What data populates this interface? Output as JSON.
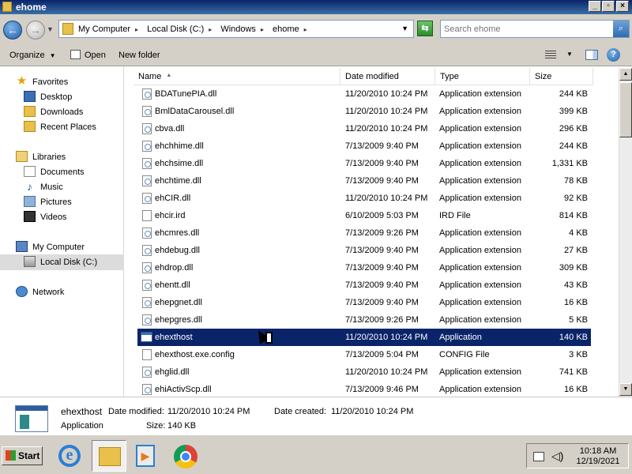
{
  "window": {
    "title": "ehome"
  },
  "address": {
    "crumbs": [
      "My Computer",
      "Local Disk (C:)",
      "Windows",
      "ehome"
    ],
    "search_placeholder": "Search ehome"
  },
  "toolbar": {
    "organize": "Organize",
    "open": "Open",
    "new_folder": "New folder"
  },
  "nav": {
    "favorites": "Favorites",
    "desktop": "Desktop",
    "downloads": "Downloads",
    "recent": "Recent Places",
    "libraries": "Libraries",
    "documents": "Documents",
    "music": "Music",
    "pictures": "Pictures",
    "videos": "Videos",
    "computer": "My Computer",
    "local_disk": "Local Disk (C:)",
    "network": "Network"
  },
  "columns": {
    "name": "Name",
    "date": "Date modified",
    "type": "Type",
    "size": "Size"
  },
  "files": [
    {
      "name": "BDATunePIA.dll",
      "date": "11/20/2010 10:24 PM",
      "type": "Application extension",
      "size": "244 KB",
      "kind": "dll"
    },
    {
      "name": "BmlDataCarousel.dll",
      "date": "11/20/2010 10:24 PM",
      "type": "Application extension",
      "size": "399 KB",
      "kind": "dll"
    },
    {
      "name": "cbva.dll",
      "date": "11/20/2010 10:24 PM",
      "type": "Application extension",
      "size": "296 KB",
      "kind": "dll"
    },
    {
      "name": "ehchhime.dll",
      "date": "7/13/2009 9:40 PM",
      "type": "Application extension",
      "size": "244 KB",
      "kind": "dll"
    },
    {
      "name": "ehchsime.dll",
      "date": "7/13/2009 9:40 PM",
      "type": "Application extension",
      "size": "1,331 KB",
      "kind": "dll"
    },
    {
      "name": "ehchtime.dll",
      "date": "7/13/2009 9:40 PM",
      "type": "Application extension",
      "size": "78 KB",
      "kind": "dll"
    },
    {
      "name": "ehCIR.dll",
      "date": "11/20/2010 10:24 PM",
      "type": "Application extension",
      "size": "92 KB",
      "kind": "dll"
    },
    {
      "name": "ehcir.ird",
      "date": "6/10/2009 5:03 PM",
      "type": "IRD File",
      "size": "814 KB",
      "kind": "file"
    },
    {
      "name": "ehcmres.dll",
      "date": "7/13/2009 9:26 PM",
      "type": "Application extension",
      "size": "4 KB",
      "kind": "dll"
    },
    {
      "name": "ehdebug.dll",
      "date": "7/13/2009 9:40 PM",
      "type": "Application extension",
      "size": "27 KB",
      "kind": "dll"
    },
    {
      "name": "ehdrop.dll",
      "date": "7/13/2009 9:40 PM",
      "type": "Application extension",
      "size": "309 KB",
      "kind": "dll"
    },
    {
      "name": "ehentt.dll",
      "date": "7/13/2009 9:40 PM",
      "type": "Application extension",
      "size": "43 KB",
      "kind": "dll"
    },
    {
      "name": "ehepgnet.dll",
      "date": "7/13/2009 9:40 PM",
      "type": "Application extension",
      "size": "16 KB",
      "kind": "dll"
    },
    {
      "name": "ehepgres.dll",
      "date": "7/13/2009 9:26 PM",
      "type": "Application extension",
      "size": "5 KB",
      "kind": "dll"
    },
    {
      "name": "ehexthost",
      "date": "11/20/2010 10:24 PM",
      "type": "Application",
      "size": "140 KB",
      "kind": "app",
      "selected": true
    },
    {
      "name": "ehexthost.exe.config",
      "date": "7/13/2009 5:04 PM",
      "type": "CONFIG File",
      "size": "3 KB",
      "kind": "file"
    },
    {
      "name": "ehglid.dll",
      "date": "11/20/2010 10:24 PM",
      "type": "Application extension",
      "size": "741 KB",
      "kind": "dll"
    },
    {
      "name": "ehiActivScp.dll",
      "date": "7/13/2009 9:46 PM",
      "type": "Application extension",
      "size": "16 KB",
      "kind": "dll"
    }
  ],
  "details": {
    "name": "ehexthost",
    "modified_label": "Date modified:",
    "modified": "11/20/2010 10:24 PM",
    "created_label": "Date created:",
    "created": "11/20/2010 10:24 PM",
    "type": "Application",
    "size_label": "Size:",
    "size": "140 KB"
  },
  "taskbar": {
    "start": "Start",
    "time": "10:18 AM",
    "date": "12/19/2021"
  }
}
